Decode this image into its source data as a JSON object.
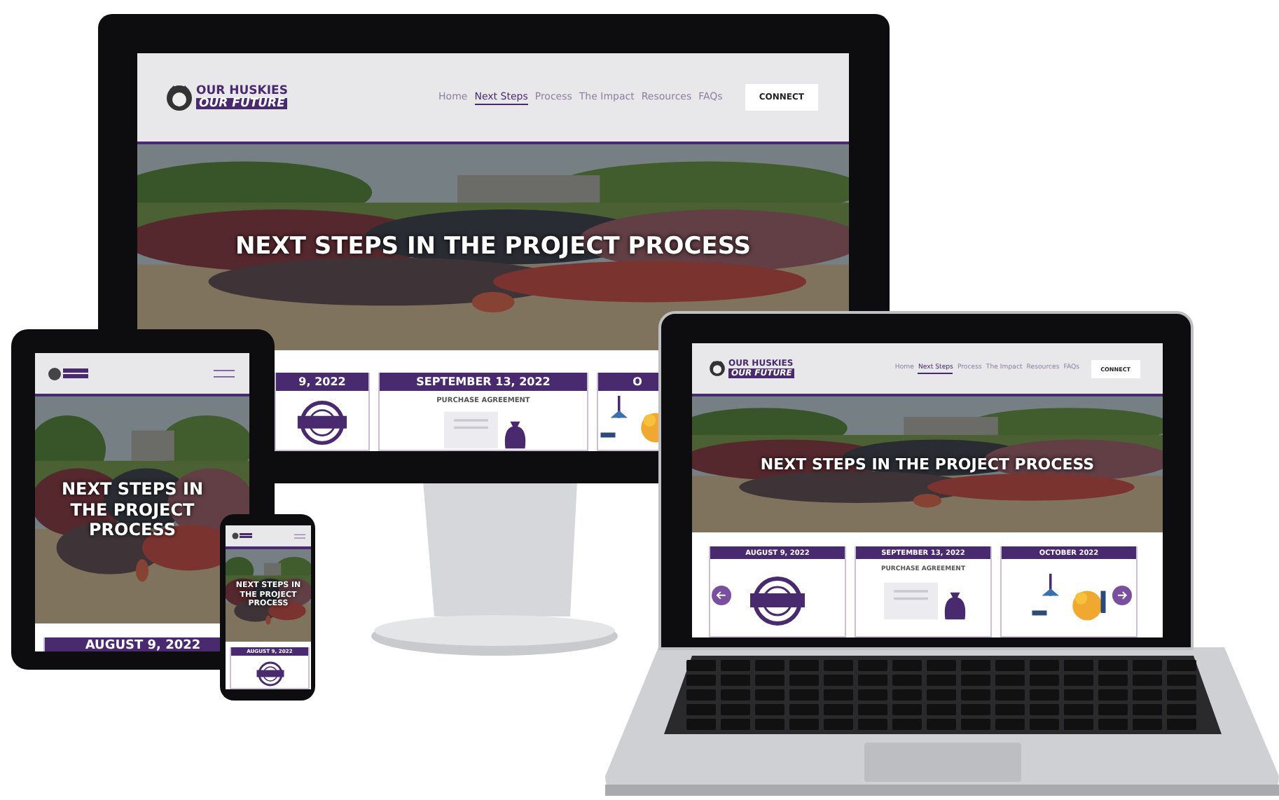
{
  "devices": [
    {
      "kind": "desktop",
      "site": {
        "logo": [
          "OUR HUSKIES",
          "OUR FUTURE"
        ],
        "nav": [
          {
            "label": "Home",
            "selected": false
          },
          {
            "label": "Next Steps",
            "selected": true
          },
          {
            "label": "Process",
            "selected": false
          },
          {
            "label": "The Impact",
            "selected": false
          },
          {
            "label": "Resources",
            "selected": false
          },
          {
            "label": "FAQs",
            "selected": false
          }
        ],
        "connect": "CONNECT",
        "hero_title": "NEXT STEPS IN THE PROJECT PROCESS",
        "cards": [
          {
            "date": "9, 2022",
            "kind": "stamp"
          },
          {
            "date": "SEPTEMBER 13, 2022",
            "kind": "agreement",
            "caption": "PURCHASE AGREEMENT"
          },
          {
            "date": "O",
            "kind": "climbers"
          }
        ]
      }
    },
    {
      "kind": "laptop",
      "site": {
        "logo": [
          "OUR HUSKIES",
          "OUR FUTURE"
        ],
        "nav": [
          {
            "label": "Home",
            "selected": false
          },
          {
            "label": "Next Steps",
            "selected": true
          },
          {
            "label": "Process",
            "selected": false
          },
          {
            "label": "The Impact",
            "selected": false
          },
          {
            "label": "Resources",
            "selected": false
          },
          {
            "label": "FAQs",
            "selected": false
          }
        ],
        "connect": "CONNECT",
        "hero_title": "NEXT STEPS IN THE PROJECT PROCESS",
        "arrows": true,
        "cards": [
          {
            "date": "AUGUST 9, 2022",
            "kind": "stamp"
          },
          {
            "date": "SEPTEMBER 13, 2022",
            "kind": "agreement",
            "caption": "PURCHASE AGREEMENT"
          },
          {
            "date": "OCTOBER 2022",
            "kind": "climbers"
          }
        ]
      }
    },
    {
      "kind": "tablet",
      "site": {
        "menu_icon": true,
        "hero_title": "NEXT STEPS IN THE PROJECT PROCESS",
        "cards": [
          {
            "date": "AUGUST 9, 2022"
          }
        ]
      }
    },
    {
      "kind": "phone",
      "site": {
        "menu_icon": true,
        "hero_title": "NEXT STEPS IN THE PROJECT PROCESS",
        "cards": [
          {
            "date": "AUGUST 9, 2022",
            "kind": "stamp"
          }
        ]
      }
    }
  ]
}
